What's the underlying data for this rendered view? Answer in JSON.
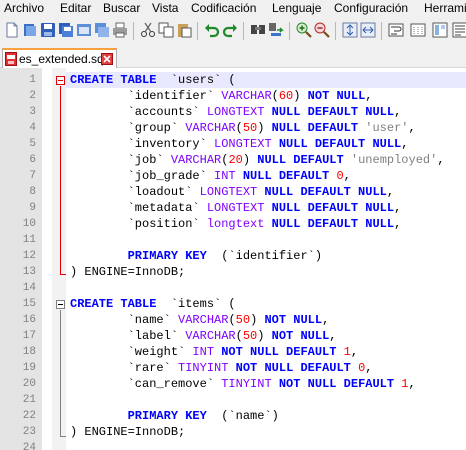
{
  "menu": [
    "Archivo",
    "Editar",
    "Buscar",
    "Vista",
    "Codificación",
    "Lenguaje",
    "Configuración",
    "Herrami"
  ],
  "toolbar_icons": [
    "new-file-icon",
    "open-file-icon",
    "save-icon",
    "save-all-icon",
    "close-icon",
    "close-all-icon",
    "print-icon",
    "cut-icon",
    "copy-icon",
    "paste-icon",
    "undo-icon",
    "redo-icon",
    "find-icon",
    "replace-icon",
    "zoom-in-icon",
    "zoom-out-icon",
    "sync-vertical-icon",
    "sync-horizontal-icon",
    "wrap-icon"
  ],
  "tab": {
    "label": "es_extended.sql"
  },
  "colors": {
    "keyword": "#0000ff",
    "type": "#8000ff",
    "number": "#ff0000",
    "string": "#808080",
    "tab_accent": "#f9a03f"
  },
  "editor": {
    "lines": [
      {
        "n": "1",
        "t": [
          [
            "kw",
            "CREATE TABLE"
          ],
          [
            "",
            "  `users` ("
          ]
        ]
      },
      {
        "n": "2",
        "t": [
          [
            "",
            "        `identifier` "
          ],
          [
            "ty",
            "VARCHAR"
          ],
          [
            "",
            "("
          ],
          [
            "num",
            "60"
          ],
          [
            "",
            ") "
          ],
          [
            "kw",
            "NOT NULL"
          ],
          [
            "",
            ","
          ]
        ]
      },
      {
        "n": "3",
        "t": [
          [
            "",
            "        `accounts` "
          ],
          [
            "ty",
            "LONGTEXT"
          ],
          [
            "",
            ""
          ],
          [
            "kw",
            " NULL DEFAULT NULL"
          ],
          [
            "",
            ","
          ]
        ]
      },
      {
        "n": "4",
        "t": [
          [
            "",
            "        `group` "
          ],
          [
            "ty",
            "VARCHAR"
          ],
          [
            "",
            "("
          ],
          [
            "num",
            "50"
          ],
          [
            "",
            ") "
          ],
          [
            "kw",
            "NULL DEFAULT"
          ],
          [
            "str",
            " 'user'"
          ],
          [
            "",
            ","
          ]
        ]
      },
      {
        "n": "5",
        "t": [
          [
            "",
            "        `inventory` "
          ],
          [
            "ty",
            "LONGTEXT"
          ],
          [
            "kw",
            " NULL DEFAULT NULL"
          ],
          [
            "",
            ","
          ]
        ]
      },
      {
        "n": "6",
        "t": [
          [
            "",
            "        `job` "
          ],
          [
            "ty",
            "VARCHAR"
          ],
          [
            "",
            "("
          ],
          [
            "num",
            "20"
          ],
          [
            "",
            ") "
          ],
          [
            "kw",
            "NULL DEFAULT"
          ],
          [
            "str",
            " 'unemployed'"
          ],
          [
            "",
            ","
          ]
        ]
      },
      {
        "n": "7",
        "t": [
          [
            "",
            "        `job_grade` "
          ],
          [
            "ty",
            "INT"
          ],
          [
            "kw",
            " NULL DEFAULT"
          ],
          [
            "num",
            " 0"
          ],
          [
            "",
            ","
          ]
        ]
      },
      {
        "n": "8",
        "t": [
          [
            "",
            "        `loadout` "
          ],
          [
            "ty",
            "LONGTEXT"
          ],
          [
            "kw",
            " NULL DEFAULT NULL"
          ],
          [
            "",
            ","
          ]
        ]
      },
      {
        "n": "9",
        "t": [
          [
            "",
            "        `metadata` "
          ],
          [
            "ty",
            "LONGTEXT"
          ],
          [
            "kw",
            " NULL DEFAULT NULL"
          ],
          [
            "",
            ","
          ]
        ]
      },
      {
        "n": "10",
        "t": [
          [
            "",
            "        `position` "
          ],
          [
            "ty",
            "longtext"
          ],
          [
            "kw",
            " NULL DEFAULT NULL"
          ],
          [
            "",
            ","
          ]
        ]
      },
      {
        "n": "11",
        "t": []
      },
      {
        "n": "12",
        "t": [
          [
            "",
            "        "
          ],
          [
            "kw",
            "PRIMARY KEY"
          ],
          [
            "",
            ""
          ],
          [
            "",
            "  (`identifier`)"
          ]
        ]
      },
      {
        "n": "13",
        "t": [
          [
            "",
            ") ENGINE=InnoDB;"
          ]
        ]
      },
      {
        "n": "14",
        "t": []
      },
      {
        "n": "15",
        "t": [
          [
            "kw",
            "CREATE TABLE"
          ],
          [
            "",
            "  `items` ("
          ]
        ]
      },
      {
        "n": "16",
        "t": [
          [
            "",
            "        `name` "
          ],
          [
            "ty",
            "VARCHAR"
          ],
          [
            "",
            "("
          ],
          [
            "num",
            "50"
          ],
          [
            "",
            ") "
          ],
          [
            "kw",
            "NOT NULL"
          ],
          [
            "",
            ","
          ]
        ]
      },
      {
        "n": "17",
        "t": [
          [
            "",
            "        `label` "
          ],
          [
            "ty",
            "VARCHAR"
          ],
          [
            "",
            "("
          ],
          [
            "num",
            "50"
          ],
          [
            "",
            ") "
          ],
          [
            "kw",
            "NOT NULL"
          ],
          [
            "",
            ","
          ]
        ]
      },
      {
        "n": "18",
        "t": [
          [
            "",
            "        `weight` "
          ],
          [
            "ty",
            "INT"
          ],
          [
            "kw",
            " NOT NULL DEFAULT"
          ],
          [
            "num",
            " 1"
          ],
          [
            "",
            ","
          ]
        ]
      },
      {
        "n": "19",
        "t": [
          [
            "",
            "        `rare` "
          ],
          [
            "ty",
            "TINYINT"
          ],
          [
            "kw",
            " NOT NULL DEFAULT"
          ],
          [
            "num",
            " 0"
          ],
          [
            "",
            ","
          ]
        ]
      },
      {
        "n": "20",
        "t": [
          [
            "",
            "        `can_remove` "
          ],
          [
            "ty",
            "TINYINT"
          ],
          [
            "kw",
            " NOT NULL DEFAULT"
          ],
          [
            "num",
            " 1"
          ],
          [
            "",
            ","
          ]
        ]
      },
      {
        "n": "21",
        "t": []
      },
      {
        "n": "22",
        "t": [
          [
            "",
            "        "
          ],
          [
            "kw",
            "PRIMARY KEY"
          ],
          [
            "",
            "  (`name`)"
          ]
        ]
      },
      {
        "n": "23",
        "t": [
          [
            "",
            ") ENGINE=InnoDB;"
          ]
        ]
      },
      {
        "n": "24",
        "t": []
      }
    ]
  }
}
